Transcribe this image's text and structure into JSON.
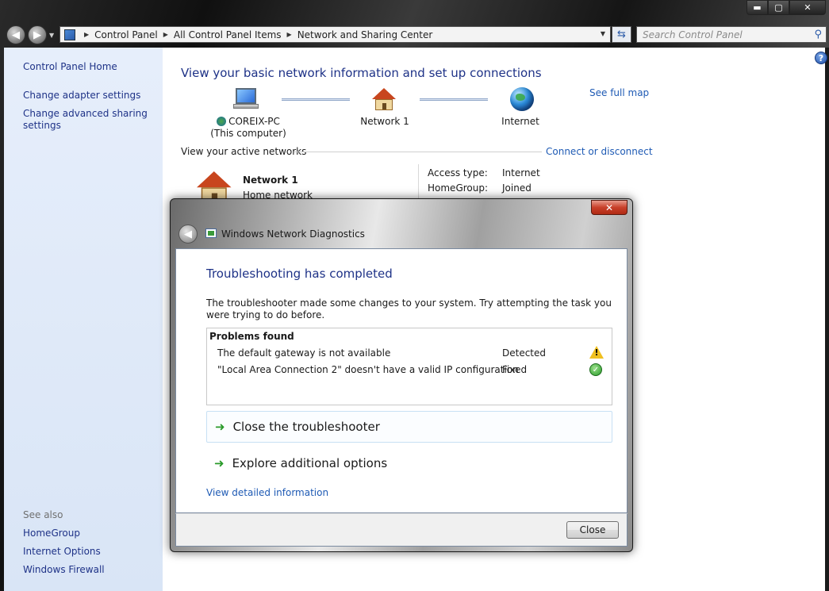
{
  "window": {
    "caption_min": "▬",
    "caption_max": "▢",
    "caption_close": "✕"
  },
  "address_bar": {
    "crumbs": [
      "Control Panel",
      "All Control Panel Items",
      "Network and Sharing Center"
    ],
    "search_placeholder": "Search Control Panel"
  },
  "left_pane": {
    "home": "Control Panel Home",
    "adapter": "Change adapter settings",
    "sharing_line1": "Change advanced sharing",
    "sharing_line2": "settings",
    "see_also": "See also",
    "see_also_items": [
      "HomeGroup",
      "Internet Options",
      "Windows Firewall"
    ]
  },
  "main": {
    "title": "View your basic network information and set up connections",
    "see_full_map": "See full map",
    "map": {
      "computer_name": "COREIX-PC",
      "computer_sub": "(This computer)",
      "network": "Network  1",
      "internet": "Internet"
    },
    "active_networks_label": "View your active networks",
    "connect_disconnect": "Connect or disconnect",
    "network_name": "Network  1",
    "network_type": "Home network",
    "access_type_label": "Access type:",
    "access_type_value": "Internet",
    "homegroup_label": "HomeGroup:",
    "homegroup_value": "Joined"
  },
  "dialog": {
    "title": "Windows Network Diagnostics",
    "close_x": "✕",
    "heading": "Troubleshooting has completed",
    "description": "The troubleshooter made some changes to your system. Try attempting the task you were trying to do before.",
    "problems_title": "Problems found",
    "problems": [
      {
        "text": "The default gateway is not available",
        "status": "Detected",
        "icon": "warning-icon"
      },
      {
        "text": "\"Local Area Connection 2\" doesn't have a valid IP configuration",
        "status": "Fixed",
        "icon": "check-icon"
      }
    ],
    "close_troubleshooter": "Close the troubleshooter",
    "explore_options": "Explore additional options",
    "view_details": "View detailed information",
    "close_button": "Close"
  }
}
